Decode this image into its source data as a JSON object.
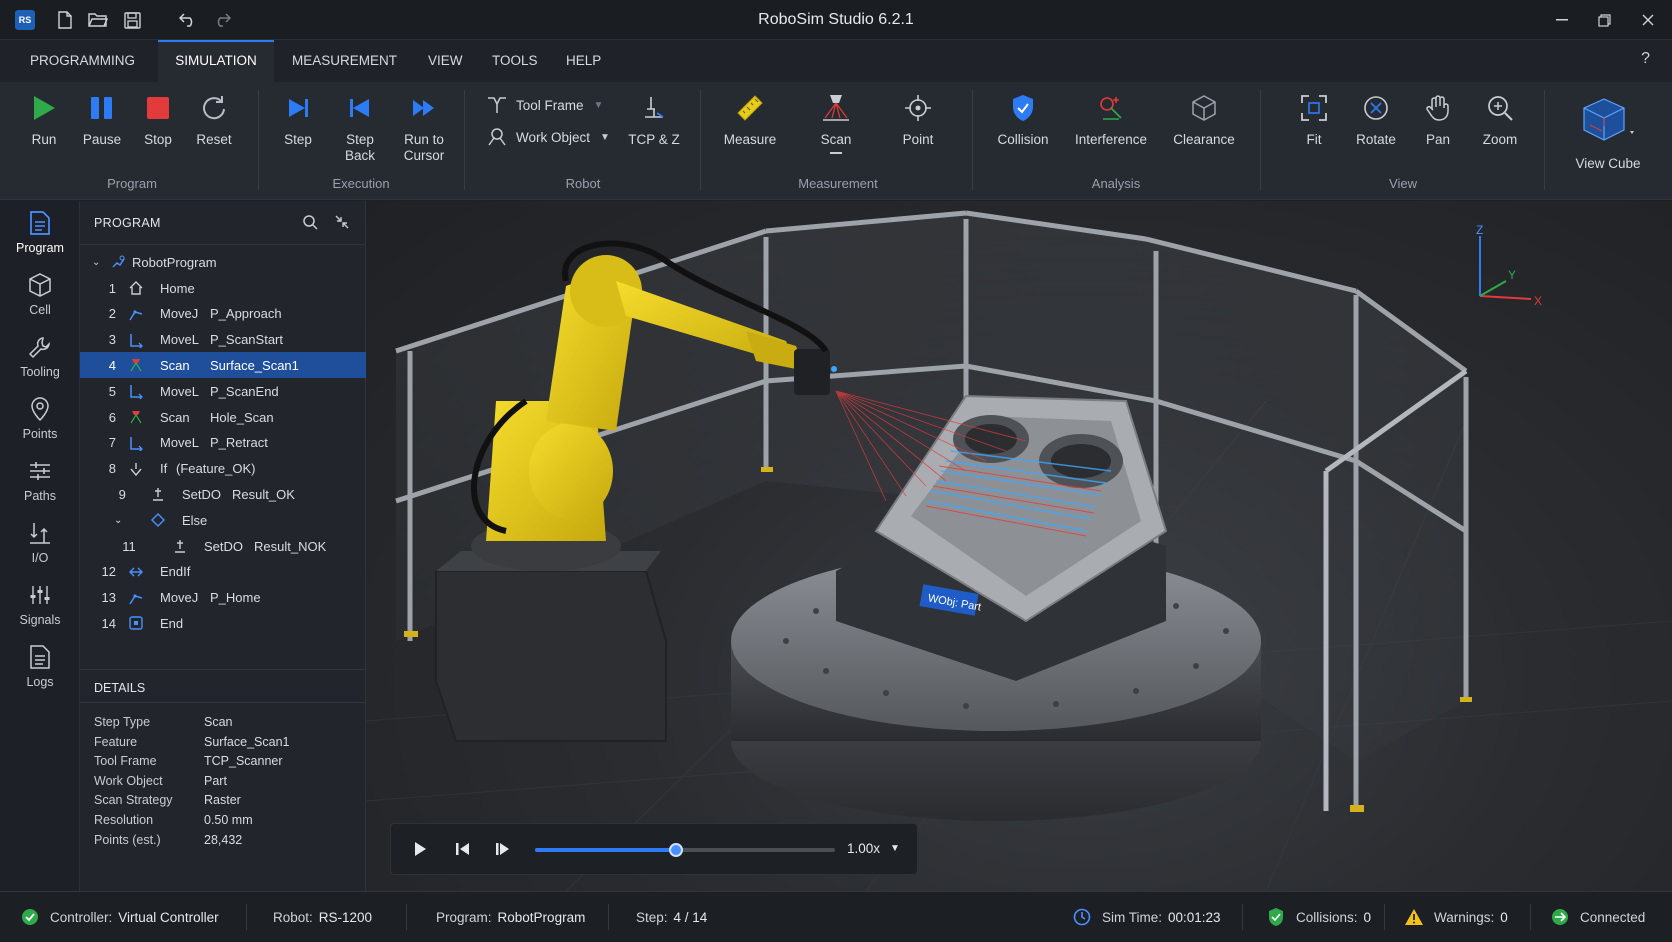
{
  "app": {
    "logo": "RS",
    "title": "RoboSim Studio 6.2.1"
  },
  "menu": {
    "tabs": [
      "PROGRAMMING",
      "SIMULATION",
      "MEASUREMENT",
      "VIEW",
      "TOOLS",
      "HELP"
    ],
    "active": "SIMULATION",
    "help": "?"
  },
  "ribbon": {
    "program": {
      "label": "Program",
      "buttons": [
        "Run",
        "Pause",
        "Stop",
        "Reset"
      ]
    },
    "execution": {
      "label": "Execution",
      "buttons": [
        "Step",
        "Step Back",
        "Run to Cursor"
      ]
    },
    "robot": {
      "label": "Robot",
      "tool_frame": "Tool Frame",
      "work_object": "Work Object",
      "tcp": "TCP & Z"
    },
    "measurement": {
      "label": "Measurement",
      "buttons": [
        "Measure",
        "Scan",
        "Point"
      ]
    },
    "analysis": {
      "label": "Analysis",
      "buttons": [
        "Collision",
        "Interference",
        "Clearance"
      ]
    },
    "view": {
      "label": "View",
      "buttons": [
        "Fit",
        "Rotate",
        "Pan",
        "Zoom"
      ]
    },
    "view_cube": "View Cube"
  },
  "rail": [
    "Program",
    "Cell",
    "Tooling",
    "Points",
    "Paths",
    "I/O",
    "Signals",
    "Logs"
  ],
  "program_panel": {
    "title": "PROGRAM",
    "root": "RobotProgram",
    "rows": [
      {
        "num": "1",
        "cmd": "Home",
        "arg": "",
        "icon": "home-icon"
      },
      {
        "num": "2",
        "cmd": "MoveJ",
        "arg": "P_Approach",
        "icon": "movej-icon"
      },
      {
        "num": "3",
        "cmd": "MoveL",
        "arg": "P_ScanStart",
        "icon": "movel-icon"
      },
      {
        "num": "4",
        "cmd": "Scan",
        "arg": "Surface_Scan1",
        "icon": "scan-icon",
        "selected": true
      },
      {
        "num": "5",
        "cmd": "MoveL",
        "arg": "P_ScanEnd",
        "icon": "movel-icon"
      },
      {
        "num": "6",
        "cmd": "Scan",
        "arg": "Hole_Scan",
        "icon": "scan-icon"
      },
      {
        "num": "7",
        "cmd": "MoveL",
        "arg": "P_Retract",
        "icon": "movel-icon"
      },
      {
        "num": "8",
        "cmd": "If",
        "arg": "(Feature_OK)",
        "icon": "if-icon"
      },
      {
        "num": "9",
        "cmd": "SetDO",
        "arg": "Result_OK",
        "icon": "setdo-icon"
      },
      {
        "num": "",
        "cmd": "Else",
        "arg": "",
        "icon": "else-icon"
      },
      {
        "num": "11",
        "cmd": "SetDO",
        "arg": "Result_NOK",
        "icon": "setdo-icon"
      },
      {
        "num": "12",
        "cmd": "EndIf",
        "arg": "",
        "icon": "endif-icon"
      },
      {
        "num": "13",
        "cmd": "MoveJ",
        "arg": "P_Home",
        "icon": "movej-icon"
      },
      {
        "num": "14",
        "cmd": "End",
        "arg": "",
        "icon": "end-icon"
      }
    ]
  },
  "details": {
    "title": "DETAILS",
    "rows": [
      {
        "k": "Step Type",
        "v": "Scan"
      },
      {
        "k": "Feature",
        "v": "Surface_Scan1"
      },
      {
        "k": "Tool Frame",
        "v": "TCP_Scanner"
      },
      {
        "k": "Work Object",
        "v": "Part"
      },
      {
        "k": "Scan Strategy",
        "v": "Raster"
      },
      {
        "k": "Resolution",
        "v": "0.50 mm"
      },
      {
        "k": "Points (est.)",
        "v": "28,432"
      }
    ]
  },
  "viewport": {
    "wobj_label": "WObj: Part",
    "axes": {
      "x": "X",
      "y": "Y",
      "z": "Z"
    }
  },
  "playback": {
    "speed": "1.00x",
    "progress": 0.47
  },
  "status": {
    "controller_label": "Controller:",
    "controller": "Virtual Controller",
    "robot_label": "Robot:",
    "robot": "RS-1200",
    "program_label": "Program:",
    "program": "RobotProgram",
    "step_label": "Step:",
    "step": "4 / 14",
    "simtime_label": "Sim Time:",
    "simtime": "00:01:23",
    "collisions_label": "Collisions:",
    "collisions": "0",
    "warnings_label": "Warnings:",
    "warnings": "0",
    "connected": "Connected"
  },
  "colors": {
    "accent": "#2d7cf6",
    "robot": "#e8cc1a",
    "selection": "#1f4f9b",
    "ok": "#2eaa4a",
    "warn": "#f2c21b",
    "stop": "#e23b3b"
  }
}
